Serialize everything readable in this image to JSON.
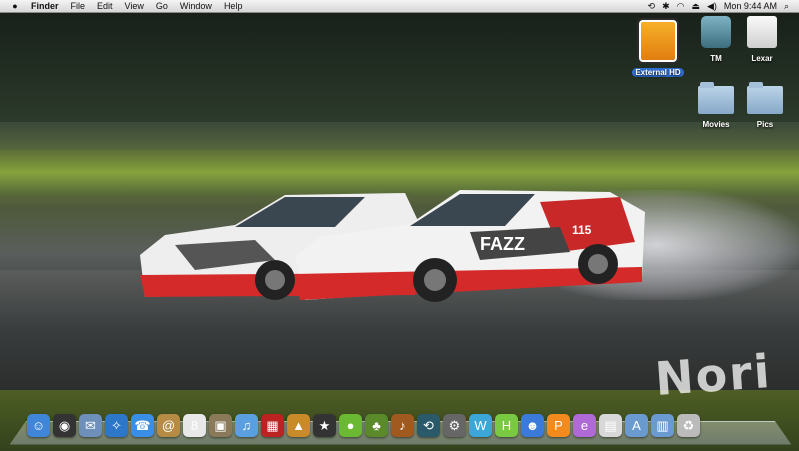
{
  "menubar": {
    "apple": "",
    "items": [
      "Finder",
      "File",
      "Edit",
      "View",
      "Go",
      "Window",
      "Help"
    ],
    "status": {
      "time_machine": "⟲",
      "bluetooth": "✱",
      "wifi": "◠",
      "eject": "⏏",
      "volume": "◀)",
      "clock": "Mon 9:44 AM",
      "spotlight": "⌕"
    }
  },
  "desktop": {
    "icons": [
      {
        "label": "External HD",
        "selected": true,
        "kind": "external-drive"
      },
      {
        "label": "TM",
        "selected": false,
        "kind": "time-machine-drive"
      },
      {
        "label": "Lexar",
        "selected": false,
        "kind": "removable-drive"
      },
      {
        "label": "Movies",
        "selected": false,
        "kind": "folder"
      },
      {
        "label": "Pics",
        "selected": false,
        "kind": "folder"
      }
    ]
  },
  "wallpaper": {
    "watermark": "Nori",
    "car_front_text": "FAZZ",
    "car_number": "115"
  },
  "dock": {
    "apps": [
      {
        "name": "finder-icon",
        "glyph": "☺",
        "color": "#3f86d8"
      },
      {
        "name": "dashboard-icon",
        "glyph": "◉",
        "color": "#333"
      },
      {
        "name": "mail-stamp-icon",
        "glyph": "✉",
        "color": "#6d8fb8"
      },
      {
        "name": "safari-icon",
        "glyph": "✧",
        "color": "#2d77c9"
      },
      {
        "name": "ichat-icon",
        "glyph": "☎",
        "color": "#3a8ee6"
      },
      {
        "name": "address-book-icon",
        "glyph": "@",
        "color": "#b58b45"
      },
      {
        "name": "ical-icon",
        "glyph": "8",
        "color": "#e8e8e8"
      },
      {
        "name": "preview-icon",
        "glyph": "▣",
        "color": "#8a7a5a"
      },
      {
        "name": "itunes-icon",
        "glyph": "♫",
        "color": "#5aa0e0"
      },
      {
        "name": "photo-booth-icon",
        "glyph": "▦",
        "color": "#b22"
      },
      {
        "name": "iphoto-icon",
        "glyph": "▲",
        "color": "#c98a2a"
      },
      {
        "name": "star-app-icon",
        "glyph": "★",
        "color": "#333"
      },
      {
        "name": "green-circle-app-icon",
        "glyph": "●",
        "color": "#6bb833"
      },
      {
        "name": "pineapple-app-icon",
        "glyph": "♣",
        "color": "#5a8a2a"
      },
      {
        "name": "garageband-icon",
        "glyph": "♪",
        "color": "#a05a20"
      },
      {
        "name": "time-machine-icon",
        "glyph": "⟲",
        "color": "#2a5a6a"
      },
      {
        "name": "system-preferences-icon",
        "glyph": "⚙",
        "color": "#666"
      },
      {
        "name": "letter-w-icon",
        "glyph": "W",
        "color": "#3aa7d8"
      },
      {
        "name": "letter-h-icon",
        "glyph": "H",
        "color": "#7ac943"
      },
      {
        "name": "people-icon",
        "glyph": "☻",
        "color": "#3a7ad8"
      },
      {
        "name": "letter-p-icon",
        "glyph": "P",
        "color": "#f28a1e"
      },
      {
        "name": "letter-e-icon",
        "glyph": "e",
        "color": "#b06ad8"
      },
      {
        "name": "spreadsheet-icon",
        "glyph": "▤",
        "color": "#d8d8d8"
      },
      {
        "name": "applications-folder-icon",
        "glyph": "A",
        "color": "#6a9ad0"
      },
      {
        "name": "documents-folder-icon",
        "glyph": "▥",
        "color": "#6a9ad0"
      },
      {
        "name": "trash-icon",
        "glyph": "♻",
        "color": "#bbb"
      }
    ]
  }
}
